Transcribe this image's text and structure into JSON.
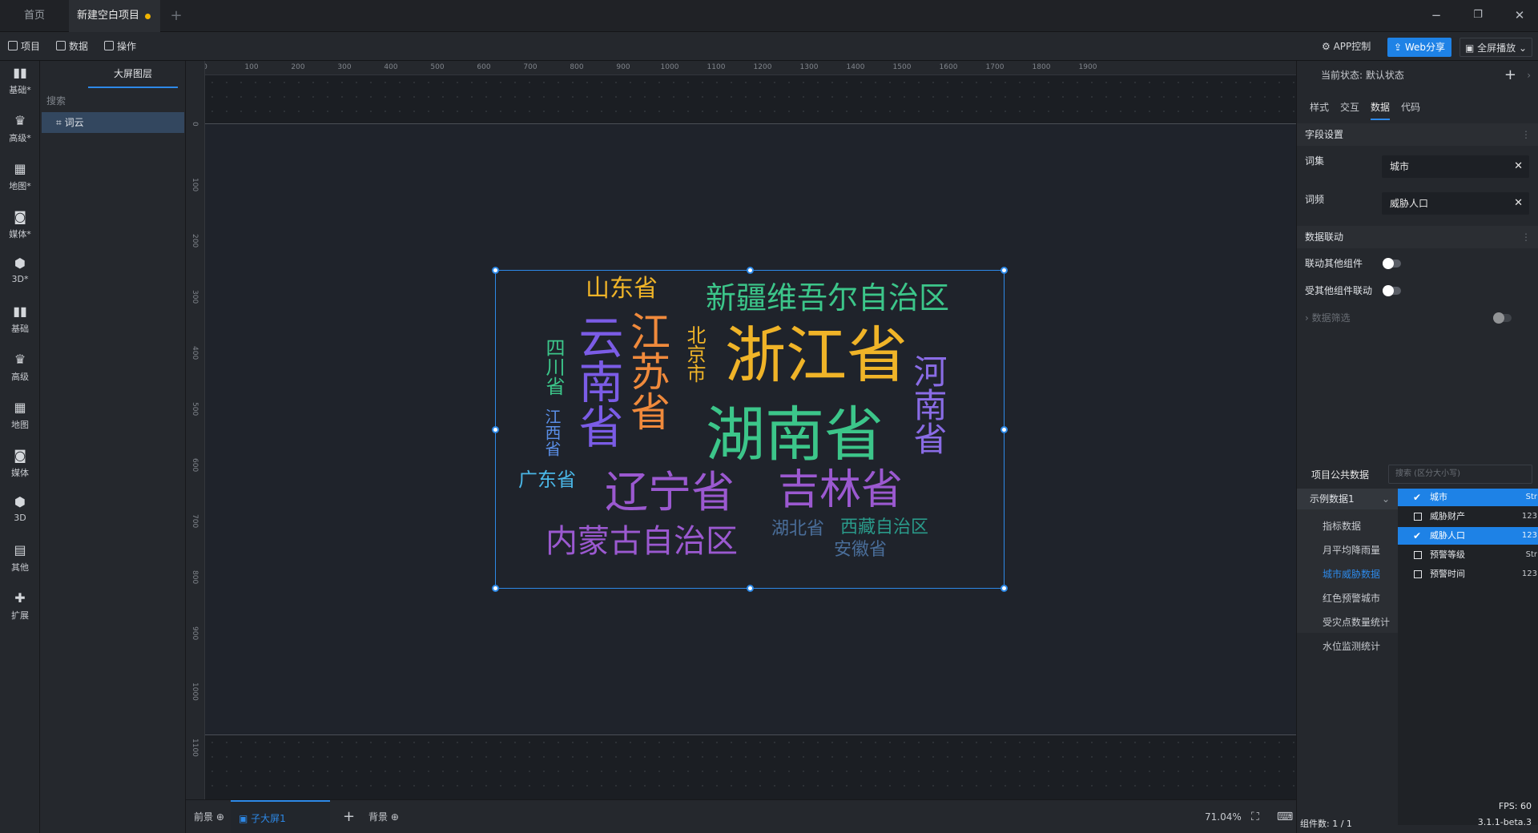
{
  "tabs": {
    "home": "首页",
    "project": "新建空白项目",
    "add": "+"
  },
  "window": {
    "minimize": "−",
    "restore": "❐",
    "close": "✕"
  },
  "toolbar": {
    "project": "项目",
    "data": "数据",
    "ops": "操作",
    "app_control": "APP控制",
    "web_share": "Web分享",
    "fullscreen": "全屏播放"
  },
  "rail": {
    "items": [
      {
        "label": "基础*",
        "icon": "bar-chart-icon"
      },
      {
        "label": "高级*",
        "icon": "crown-icon"
      },
      {
        "label": "地图*",
        "icon": "map-icon"
      },
      {
        "label": "媒体*",
        "icon": "media-icon"
      },
      {
        "label": "3D*",
        "icon": "cube-icon"
      },
      {
        "label": "基础",
        "icon": "bar-chart-icon"
      },
      {
        "label": "高级",
        "icon": "crown-icon"
      },
      {
        "label": "地图",
        "icon": "map-icon"
      },
      {
        "label": "媒体",
        "icon": "media-icon"
      },
      {
        "label": "3D",
        "icon": "cube-icon"
      },
      {
        "label": "其他",
        "icon": "layers-icon"
      },
      {
        "label": "扩展",
        "icon": "puzzle-icon"
      }
    ]
  },
  "layers": {
    "tab": "大屏图层",
    "search_placeholder": "搜索",
    "row": "词云"
  },
  "ruler": {
    "top": [
      "0",
      "100",
      "200",
      "300",
      "400",
      "500",
      "600",
      "700",
      "800",
      "900",
      "1000",
      "1100",
      "1200",
      "1300",
      "1400",
      "1500",
      "1600",
      "1700",
      "1800",
      "1900"
    ],
    "left": [
      "0",
      "100",
      "200",
      "300",
      "400",
      "500",
      "600",
      "700",
      "800",
      "900",
      "1000",
      "1100"
    ]
  },
  "wordcloud": {
    "words": [
      {
        "text": "浙江省",
        "color": "#f0b428"
      },
      {
        "text": "湖南省",
        "color": "#3cc68a"
      },
      {
        "text": "新疆维吾尔自治区",
        "color": "#3cc68a"
      },
      {
        "text": "山东省",
        "color": "#f0b428"
      },
      {
        "text": "云南省",
        "color": "#7b5ce6"
      },
      {
        "text": "江苏省",
        "color": "#f08a3c"
      },
      {
        "text": "北京市",
        "color": "#f0b428"
      },
      {
        "text": "四川省",
        "color": "#3cc68a"
      },
      {
        "text": "江西省",
        "color": "#5a8ee6"
      },
      {
        "text": "河南省",
        "color": "#8a6ce6"
      },
      {
        "text": "广东省",
        "color": "#4ab6e6"
      },
      {
        "text": "辽宁省",
        "color": "#9b59d0"
      },
      {
        "text": "吉林省",
        "color": "#9b59d0"
      },
      {
        "text": "内蒙古自治区",
        "color": "#9b59d0"
      },
      {
        "text": "湖北省",
        "color": "#4a6e9a"
      },
      {
        "text": "西藏自治区",
        "color": "#2a9a8a"
      },
      {
        "text": "安徽省",
        "color": "#4a6e9a"
      }
    ]
  },
  "bottombar": {
    "front": "前景",
    "screen": "子大屏1",
    "add": "+",
    "background": "背景",
    "zoom": "71.04%"
  },
  "right": {
    "state_label": "当前状态:  默认状态",
    "tabs": [
      "样式",
      "交互",
      "数据",
      "代码"
    ],
    "active_tab": "数据",
    "field_section": "字段设置",
    "word_set_label": "词集",
    "word_set_value": "城市",
    "word_freq_label": "词频",
    "word_freq_value": "威胁人口",
    "linkage_section": "数据联动",
    "link_other": "联动其他组件",
    "linked_by_other": "受其他组件联动",
    "data_filter": "数据筛选",
    "public_data_title": "项目公共数据",
    "public_search_placeholder": "搜索 (区分大小写)",
    "dataset_selected": "示例数据1",
    "datasets": [
      "指标数据",
      "月平均降雨量",
      "城市威胁数据",
      "红色预警城市",
      "受灾点数量统计",
      "水位监测统计"
    ],
    "active_dataset": "城市威胁数据",
    "fields": [
      {
        "name": "城市",
        "type": "Str",
        "checked": true
      },
      {
        "name": "威胁财产",
        "type": "123",
        "checked": false
      },
      {
        "name": "威胁人口",
        "type": "123",
        "checked": true
      },
      {
        "name": "预警等级",
        "type": "Str",
        "checked": false
      },
      {
        "name": "预警时间",
        "type": "123",
        "checked": false
      }
    ],
    "fps": "FPS: 60",
    "component_count": "组件数: 1 / 1",
    "version": "3.1.1-beta.3"
  }
}
